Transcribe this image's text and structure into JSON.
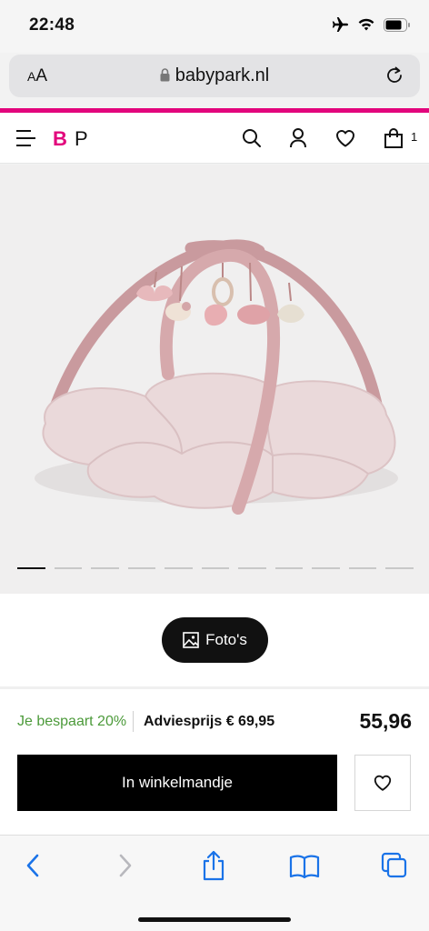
{
  "status_bar": {
    "time": "22:48"
  },
  "browser": {
    "aa_label_big": "A",
    "aa_label_small": "A",
    "url": "babypark.nl"
  },
  "header": {
    "logo_b": "B",
    "logo_p": "P",
    "cart_count": "1"
  },
  "gallery": {
    "slide_count": 11,
    "active_slide": 1
  },
  "fotos_button": {
    "label": "Foto's"
  },
  "product": {
    "savings": "Je bespaart 20%",
    "advice_price": "Adviesprijs € 69,95",
    "price": "55,96"
  },
  "actions": {
    "add_to_cart": "In winkelmandje"
  },
  "colors": {
    "brand_pink": "#e2057c",
    "savings_green": "#4c9a3a",
    "ios_blue": "#1a73e8"
  }
}
